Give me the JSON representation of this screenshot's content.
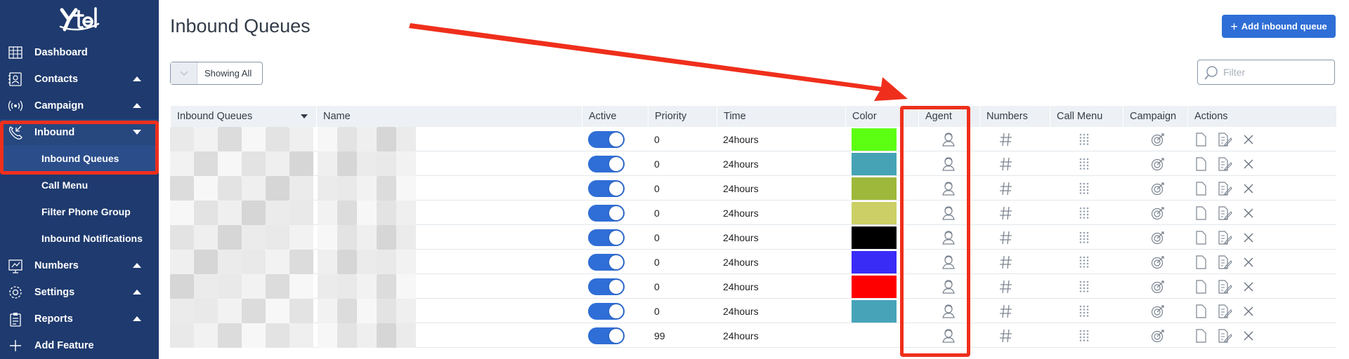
{
  "logo": {
    "text": "Ytel"
  },
  "sidebar": {
    "items": [
      {
        "label": "Dashboard",
        "icon": "dashboard-icon",
        "caret": "none"
      },
      {
        "label": "Contacts",
        "icon": "contacts-icon",
        "caret": "up"
      },
      {
        "label": "Campaign",
        "icon": "broadcast-icon",
        "caret": "up"
      },
      {
        "label": "Inbound",
        "icon": "inbound-call-icon",
        "caret": "down"
      },
      {
        "label": "Numbers",
        "icon": "numbers-icon",
        "caret": "up"
      },
      {
        "label": "Settings",
        "icon": "gear-icon",
        "caret": "up"
      },
      {
        "label": "Reports",
        "icon": "clipboard-icon",
        "caret": "up"
      },
      {
        "label": "Add Feature",
        "icon": "plus-icon",
        "caret": "none"
      }
    ],
    "sub_items": [
      {
        "label": "Inbound Queues"
      },
      {
        "label": "Call Menu"
      },
      {
        "label": "Filter Phone Group"
      },
      {
        "label": "Inbound Notifications"
      }
    ]
  },
  "header": {
    "title": "Inbound Queues",
    "add_button": "Add inbound queue"
  },
  "toolbar": {
    "showing": "Showing All",
    "filter_placeholder": "Filter"
  },
  "table": {
    "columns": [
      "Inbound Queues",
      "Name",
      "Active",
      "Priority",
      "Time",
      "Color",
      "Agent",
      "Numbers",
      "Call Menu",
      "Campaign",
      "Actions"
    ],
    "rows": [
      {
        "priority": "0",
        "time": "24hours",
        "color": "#5cff12",
        "active": true
      },
      {
        "priority": "0",
        "time": "24hours",
        "color": "#45a3b5",
        "active": true
      },
      {
        "priority": "0",
        "time": "24hours",
        "color": "#9db83a",
        "active": true
      },
      {
        "priority": "0",
        "time": "24hours",
        "color": "#cccf66",
        "active": true
      },
      {
        "priority": "0",
        "time": "24hours",
        "color": "#000000",
        "active": true
      },
      {
        "priority": "0",
        "time": "24hours",
        "color": "#3a2cf7",
        "active": true
      },
      {
        "priority": "0",
        "time": "24hours",
        "color": "#ff0000",
        "active": true
      },
      {
        "priority": "0",
        "time": "24hours",
        "color": "#47a4b8",
        "active": true
      },
      {
        "priority": "99",
        "time": "24hours",
        "color": "",
        "active": true
      }
    ]
  },
  "colors": {
    "sidebar": "#1e3a6e",
    "accent": "#2f6ed6",
    "annotation": "#ef2f1c"
  }
}
